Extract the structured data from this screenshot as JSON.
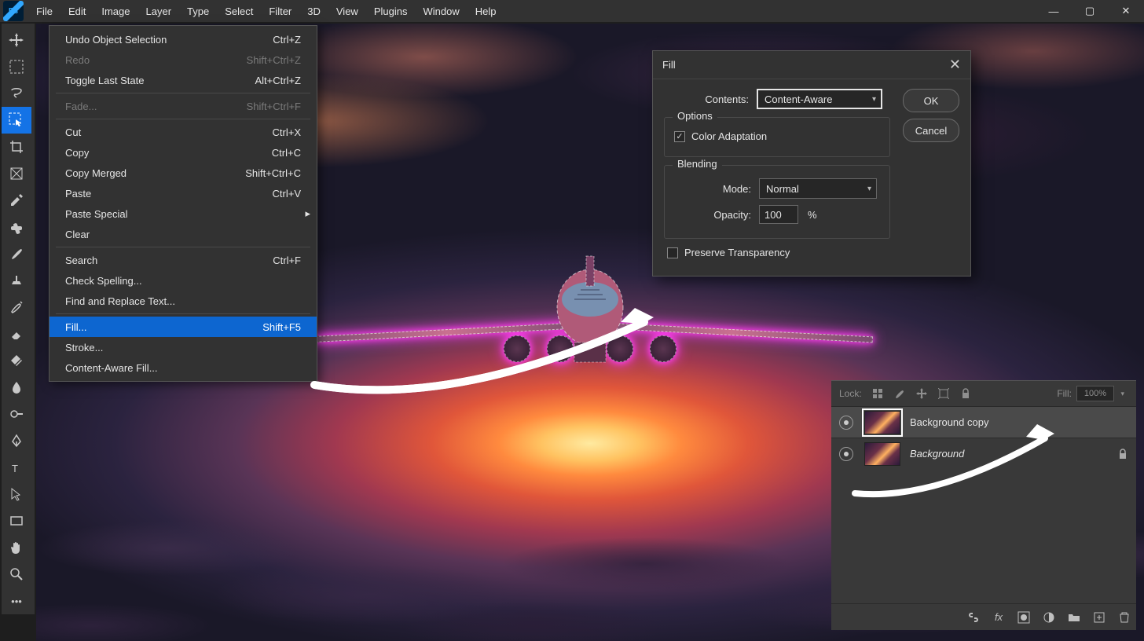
{
  "menubar": {
    "items": [
      "File",
      "Edit",
      "Image",
      "Layer",
      "Type",
      "Select",
      "Filter",
      "3D",
      "View",
      "Plugins",
      "Window",
      "Help"
    ]
  },
  "editMenu": {
    "items": [
      {
        "label": "Undo Object Selection",
        "shortcut": "Ctrl+Z"
      },
      {
        "label": "Redo",
        "shortcut": "Shift+Ctrl+Z",
        "disabled": true
      },
      {
        "label": "Toggle Last State",
        "shortcut": "Alt+Ctrl+Z"
      },
      {
        "sep": true
      },
      {
        "label": "Fade...",
        "shortcut": "Shift+Ctrl+F",
        "disabled": true
      },
      {
        "sep": true
      },
      {
        "label": "Cut",
        "shortcut": "Ctrl+X"
      },
      {
        "label": "Copy",
        "shortcut": "Ctrl+C"
      },
      {
        "label": "Copy Merged",
        "shortcut": "Shift+Ctrl+C"
      },
      {
        "label": "Paste",
        "shortcut": "Ctrl+V"
      },
      {
        "label": "Paste Special",
        "sub": true
      },
      {
        "label": "Clear"
      },
      {
        "sep": true
      },
      {
        "label": "Search",
        "shortcut": "Ctrl+F"
      },
      {
        "label": "Check Spelling..."
      },
      {
        "label": "Find and Replace Text..."
      },
      {
        "sep": true
      },
      {
        "label": "Fill...",
        "shortcut": "Shift+F5",
        "highlighted": true
      },
      {
        "label": "Stroke..."
      },
      {
        "label": "Content-Aware Fill..."
      }
    ]
  },
  "fillDialog": {
    "title": "Fill",
    "contentsLabel": "Contents:",
    "contentsValue": "Content-Aware",
    "ok": "OK",
    "cancel": "Cancel",
    "optionsLegend": "Options",
    "colorAdaptation": "Color Adaptation",
    "blendingLegend": "Blending",
    "modeLabel": "Mode:",
    "modeValue": "Normal",
    "opacityLabel": "Opacity:",
    "opacityValue": "100",
    "opacitySuffix": "%",
    "preserveTransparency": "Preserve Transparency"
  },
  "layers": {
    "lockLabel": "Lock:",
    "fillLabel": "Fill:",
    "fillValue": "100%",
    "rows": [
      {
        "name": "Background copy",
        "selected": true
      },
      {
        "name": "Background",
        "italic": true,
        "locked": true
      }
    ]
  }
}
